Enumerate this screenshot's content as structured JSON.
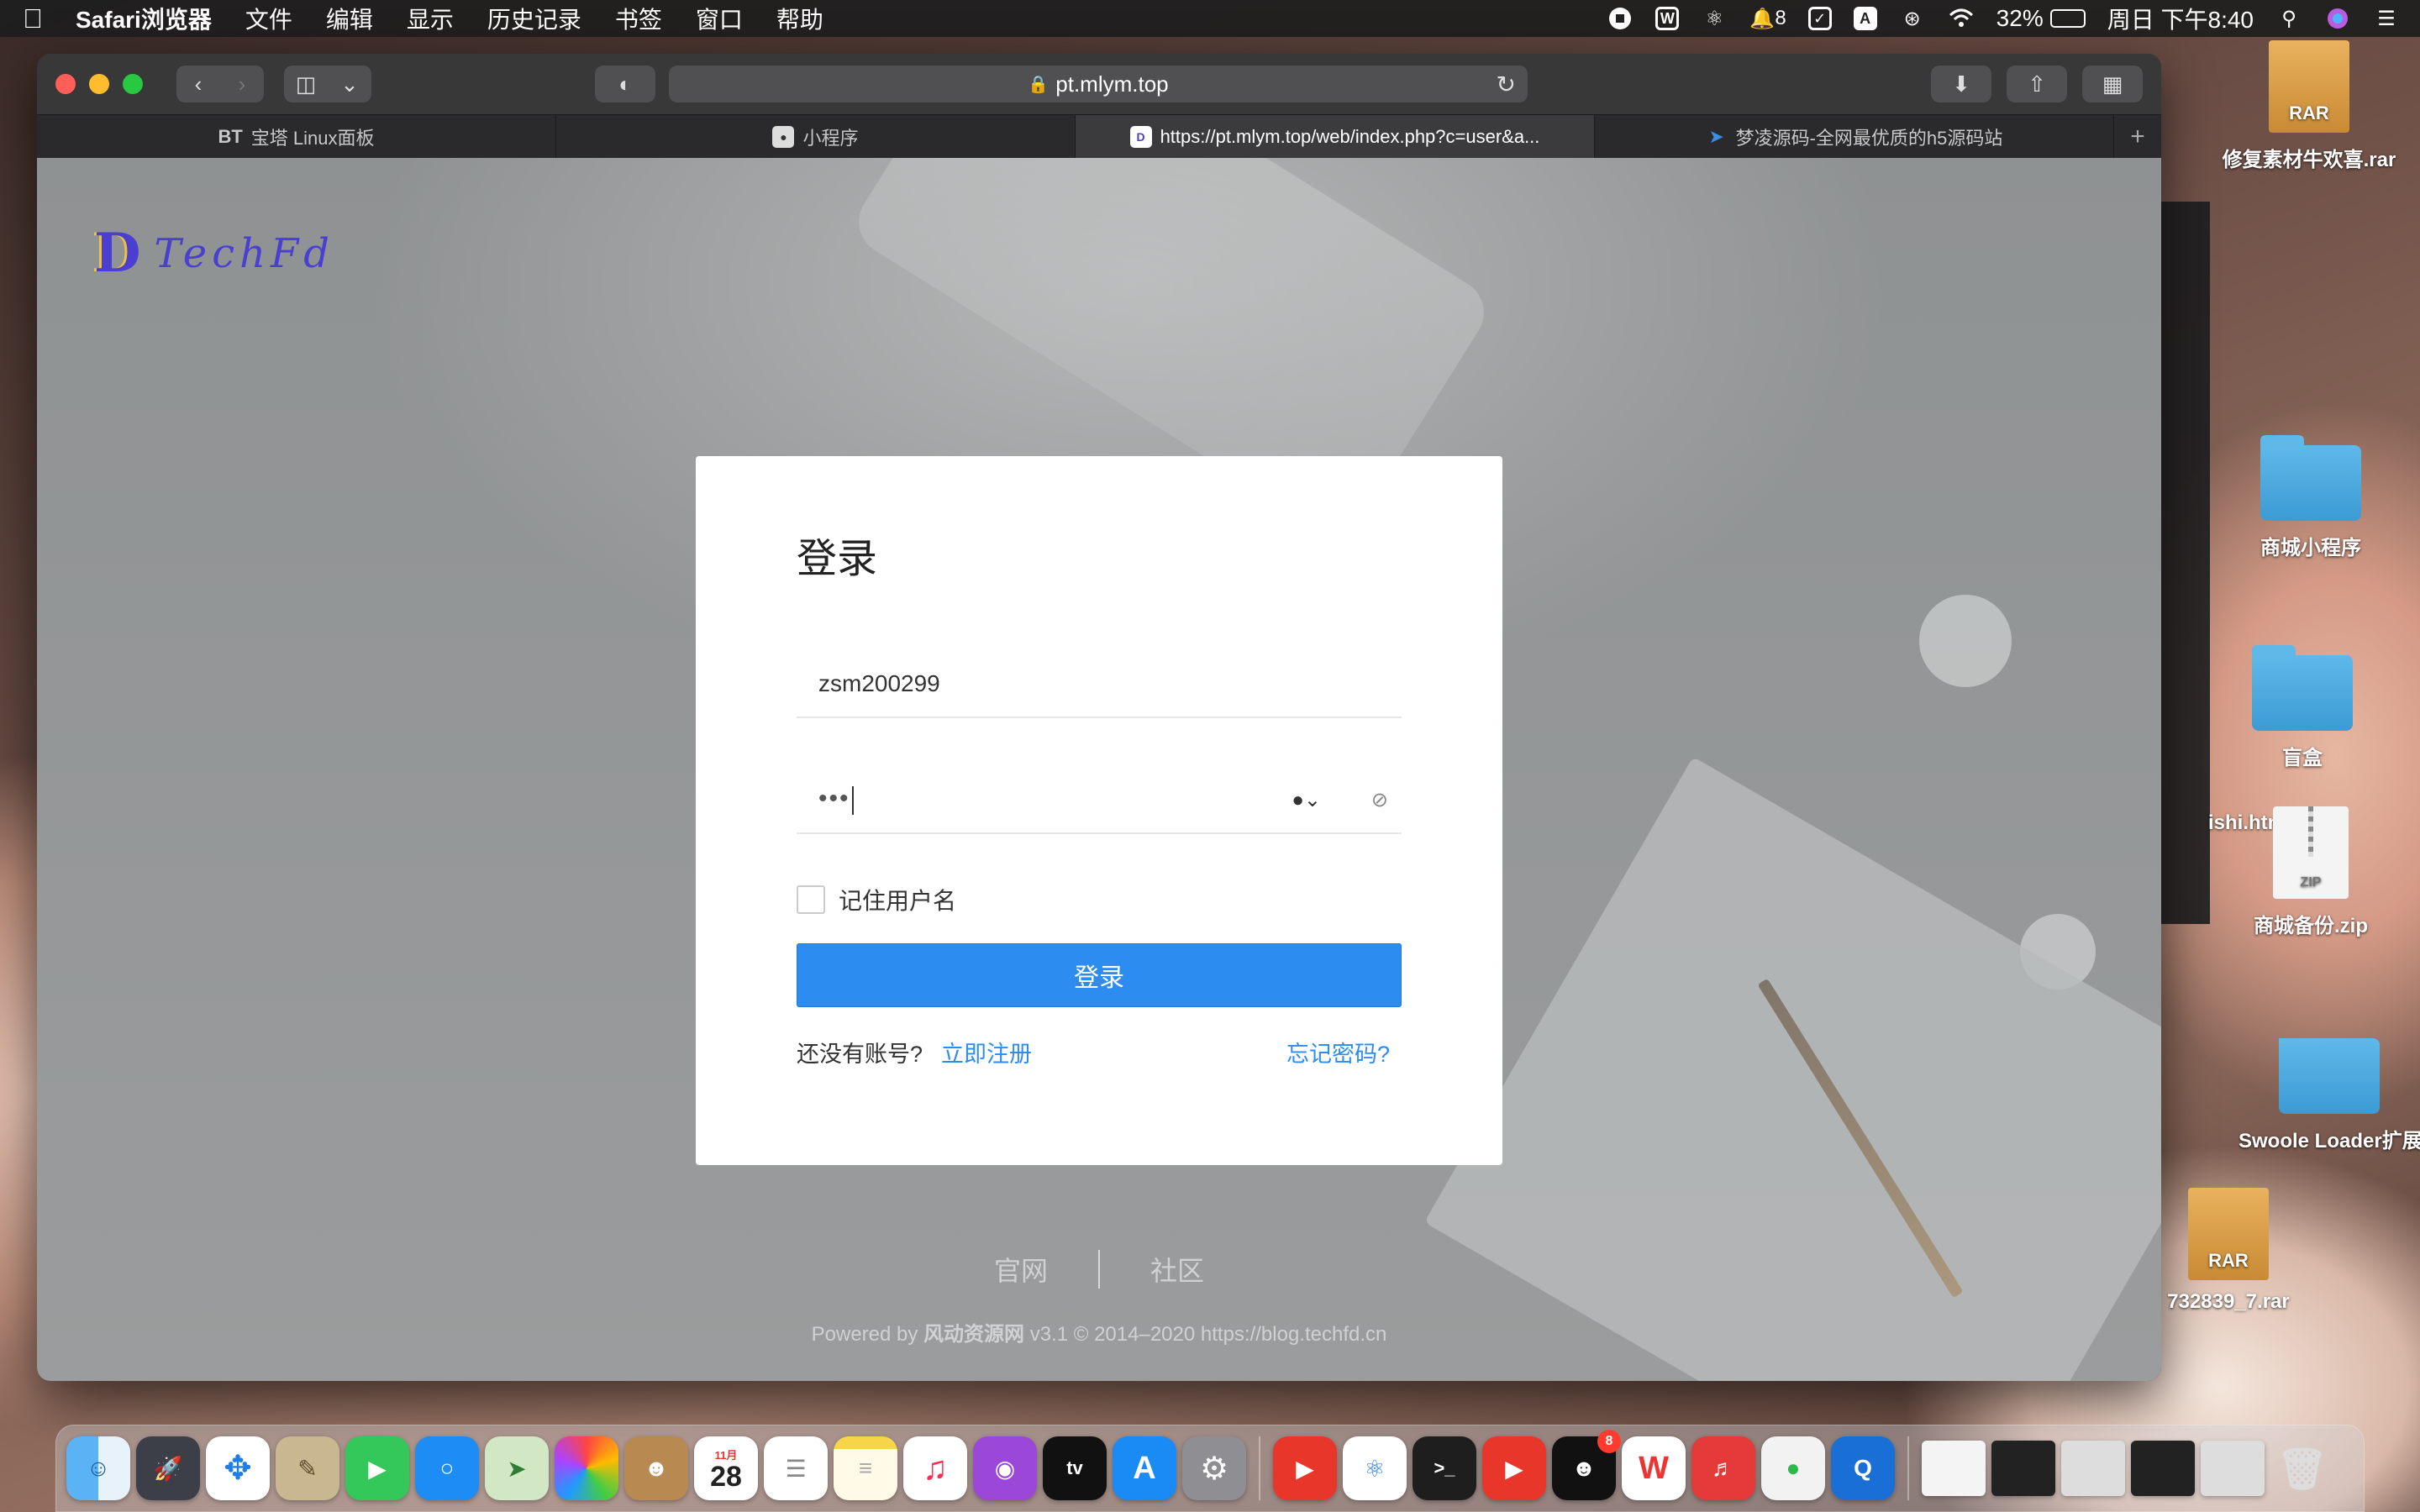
{
  "menubar": {
    "app_name": "Safari浏览器",
    "menus": [
      "文件",
      "编辑",
      "显示",
      "历史记录",
      "书签",
      "窗口",
      "帮助"
    ],
    "notification_count": "8",
    "input_method": "A",
    "battery": "32%",
    "battery_level": 0.32,
    "datetime": "周日 下午8:40"
  },
  "browser": {
    "url": "pt.mlym.top",
    "tabs": [
      {
        "favicon": "BT",
        "title": "宝塔 Linux面板"
      },
      {
        "favicon": "wechat-icon",
        "title": "小程序"
      },
      {
        "favicon": "D",
        "title": "https://pt.mlym.top/web/index.php?c=user&a..."
      },
      {
        "favicon": "arrow-icon",
        "title": "梦凌源码-全网最优质的h5源码站"
      }
    ]
  },
  "site": {
    "logo_text": "TechFd",
    "login": {
      "title": "登录",
      "username": "zsm200299",
      "password_mask": "•••",
      "remember_label": "记住用户名",
      "submit_label": "登录",
      "no_account": "还没有账号?",
      "register": "立即注册",
      "forgot": "忘记密码?"
    },
    "footer": {
      "links": [
        "官网",
        "社区"
      ],
      "copy_prefix": "Powered by ",
      "copy_brand": "风动资源网",
      "copy_suffix": " v3.1 © 2014–2020 https://blog.techfd.cn"
    }
  },
  "desktop": {
    "items": [
      {
        "type": "rar",
        "label": "修复素材牛欢喜.rar"
      },
      {
        "type": "folder",
        "label": "商城小程序"
      },
      {
        "type": "folder",
        "label": "盲盒"
      },
      {
        "type": "partial",
        "label": "ishi.html"
      },
      {
        "type": "zip",
        "label": "商城备份.zip"
      },
      {
        "type": "folder",
        "label": "Swoole Loader扩展"
      },
      {
        "type": "rar",
        "label": "732839_7.rar"
      }
    ]
  },
  "dock": {
    "calendar_month": "11月",
    "calendar_day": "28",
    "qq_badge": "8"
  }
}
